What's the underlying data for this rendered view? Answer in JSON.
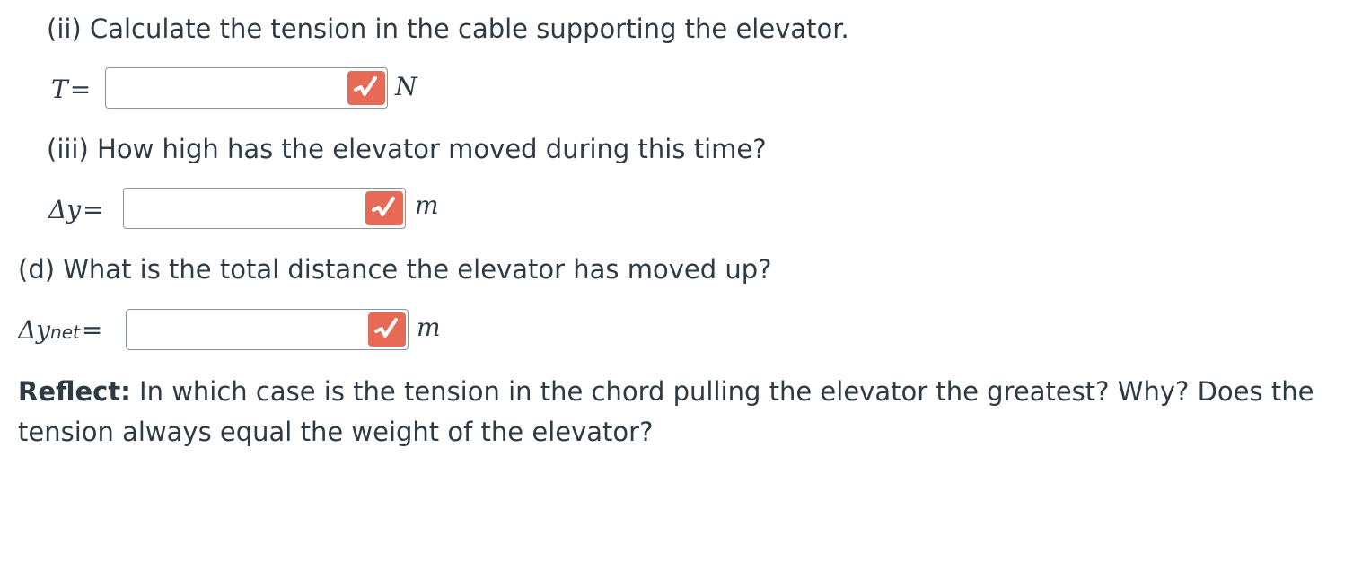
{
  "questions": {
    "q2": {
      "text": "(ii) Calculate the tension in the cable supporting the elevator.",
      "label": "T",
      "equals": "=",
      "value": "",
      "unit": "N"
    },
    "q3": {
      "text": "(iii) How high has the elevator moved during this time?",
      "label": "Δy",
      "equals": "=",
      "value": "",
      "unit": "m"
    },
    "qd": {
      "text": "(d) What is the total distance the elevator has moved up?",
      "label": "Δy",
      "label_sub": "net",
      "equals": "=",
      "value": "",
      "unit": "m"
    }
  },
  "reflect": {
    "bold": "Reflect:",
    "text": " In which case is the tension in the chord pulling the elevator the greatest? Why? Does the tension always equal the weight of the elevator?"
  },
  "icons": {
    "check": "square-root-check-icon"
  },
  "colors": {
    "check_bg": "#e66a56",
    "text": "#2d3b45"
  }
}
